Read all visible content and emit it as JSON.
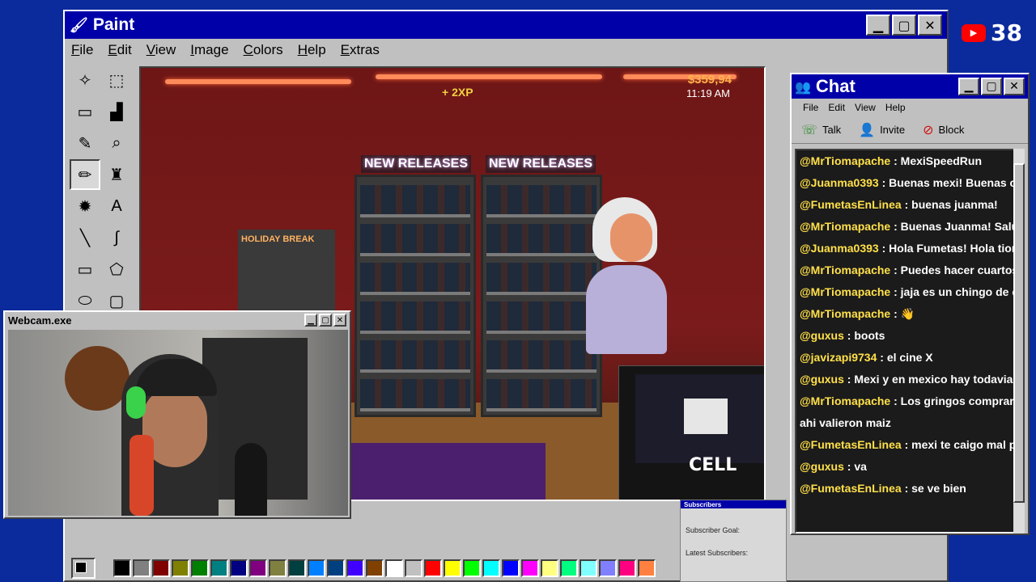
{
  "paint": {
    "title": "Paint",
    "menu": [
      "File",
      "Edit",
      "View",
      "Image",
      "Colors",
      "Help",
      "Extras"
    ],
    "tools": [
      {
        "name": "free-select-icon",
        "glyph": "✧"
      },
      {
        "name": "select-icon",
        "glyph": "⬚"
      },
      {
        "name": "eraser-icon",
        "glyph": "▭"
      },
      {
        "name": "fill-icon",
        "glyph": "▟"
      },
      {
        "name": "picker-icon",
        "glyph": "✎"
      },
      {
        "name": "magnifier-icon",
        "glyph": "⌕"
      },
      {
        "name": "pencil-icon",
        "glyph": "✏"
      },
      {
        "name": "brush-icon",
        "glyph": "♜"
      },
      {
        "name": "airbrush-icon",
        "glyph": "✹"
      },
      {
        "name": "text-icon",
        "glyph": "A"
      },
      {
        "name": "line-icon",
        "glyph": "╲"
      },
      {
        "name": "curve-icon",
        "glyph": "∫"
      },
      {
        "name": "rectangle-icon",
        "glyph": "▭"
      },
      {
        "name": "polygon-icon",
        "glyph": "⬠"
      },
      {
        "name": "ellipse-icon",
        "glyph": "⬭"
      },
      {
        "name": "rounded-rect-icon",
        "glyph": "▢"
      }
    ],
    "palette": [
      "#000000",
      "#808080",
      "#800000",
      "#808000",
      "#008000",
      "#008080",
      "#000080",
      "#800080",
      "#808040",
      "#004040",
      "#0080ff",
      "#004080",
      "#4000ff",
      "#804000",
      "#ffffff",
      "#c0c0c0",
      "#ff0000",
      "#ffff00",
      "#00ff00",
      "#00ffff",
      "#0000ff",
      "#ff00ff",
      "#ffff80",
      "#00ff80",
      "#80ffff",
      "#8080ff",
      "#ff0080",
      "#ff8040"
    ]
  },
  "game": {
    "money": "$359,94",
    "time": "11:19 AM",
    "xp": "+ 2XP",
    "sign_left": "NEW RELEASES",
    "sign_right": "NEW RELEASES",
    "poster": "HOLIDAY BREAK"
  },
  "stream_preview": {
    "overlay_text": "CELL"
  },
  "webcam": {
    "title": "Webcam.exe"
  },
  "chat": {
    "title": "Chat",
    "menu": [
      "File",
      "Edit",
      "View",
      "Help"
    ],
    "actions": [
      {
        "label": "Talk",
        "icon": "talk-icon"
      },
      {
        "label": "Invite",
        "icon": "invite-icon"
      },
      {
        "label": "Block",
        "icon": "block-icon"
      }
    ],
    "messages": [
      {
        "user": "@MrTiomapache",
        "text": "MexiSpeedRun"
      },
      {
        "user": "@Juanma0393",
        "text": "Buenas mexi! Buenas che"
      },
      {
        "user": "@FumetasEnLinea",
        "text": "buenas juanma!"
      },
      {
        "user": "@MrTiomapache",
        "text": "Buenas Juanma! Saludos"
      },
      {
        "user": "@Juanma0393",
        "text": "Hola Fumetas! Hola tiom"
      },
      {
        "user": "@MrTiomapache",
        "text": "Puedes hacer cuartos po"
      },
      {
        "user": "@MrTiomapache",
        "text": "jaja es un chingo de espa"
      },
      {
        "user": "@MrTiomapache",
        "text": "👋"
      },
      {
        "user": "@guxus",
        "text": "boots"
      },
      {
        "user": "@javizapi9734",
        "text": "el cine X"
      },
      {
        "user": "@guxus",
        "text": "Mexi y en mexico hay todavia esos"
      },
      {
        "user": "@MrTiomapache",
        "text": "Los gringos compraron to"
      },
      {
        "user": "",
        "text": "ahi valieron maiz"
      },
      {
        "user": "@FumetasEnLinea",
        "text": "mexi te caigo mal por s"
      },
      {
        "user": "@guxus",
        "text": "va"
      },
      {
        "user": "@FumetasEnLinea",
        "text": "se ve bien"
      }
    ]
  },
  "youtube": {
    "count": "38"
  },
  "subscribers": {
    "title": "Subscribers",
    "goal_label": "Subscriber Goal:",
    "latest_label": "Latest Subscribers:"
  }
}
